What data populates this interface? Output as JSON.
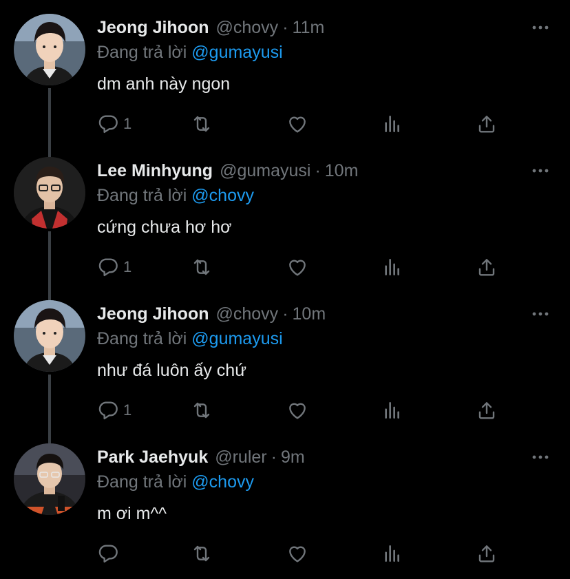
{
  "replying_prefix": "Đang trả lời",
  "tweets": [
    {
      "name": "Jeong Jihoon",
      "handle": "@chovy",
      "separator": "·",
      "time": "11m",
      "replying_to": "@gumayusi",
      "text": "dm anh này ngon",
      "reply_count": "1",
      "avatar": "avatar-chovy"
    },
    {
      "name": "Lee Minhyung",
      "handle": "@gumayusi",
      "separator": "·",
      "time": "10m",
      "replying_to": "@chovy",
      "text": "cứng chưa hơ hơ",
      "reply_count": "1",
      "avatar": "avatar-gumayusi"
    },
    {
      "name": "Jeong Jihoon",
      "handle": "@chovy",
      "separator": "·",
      "time": "10m",
      "replying_to": "@gumayusi",
      "text": "như đá luôn ấy chứ",
      "reply_count": "1",
      "avatar": "avatar-chovy"
    },
    {
      "name": "Park Jaehyuk",
      "handle": "@ruler",
      "separator": "·",
      "time": "9m",
      "replying_to": "@chovy",
      "text": "m ơi m^^",
      "reply_count": "",
      "avatar": "avatar-ruler"
    }
  ],
  "icons": [
    "reply-icon",
    "retweet-icon",
    "like-icon",
    "views-icon",
    "share-icon",
    "more-icon"
  ],
  "colors": {
    "background": "#000000",
    "text": "#e7e9ea",
    "muted": "#71767b",
    "accent": "#1d9bf0",
    "thread": "#3a3f44"
  }
}
